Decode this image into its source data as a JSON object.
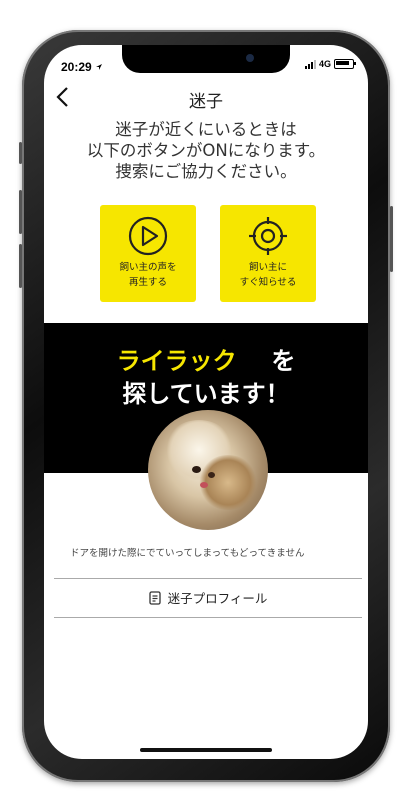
{
  "status_bar": {
    "time": "20:29",
    "network": "4G"
  },
  "nav": {
    "title": "迷子"
  },
  "intro": {
    "lines": [
      "迷子が近くにいるときは",
      "以下のボタンがONになります。",
      "捜索にご協力ください。"
    ]
  },
  "actions": {
    "play_voice": {
      "line1": "飼い主の声を",
      "line2": "再生する"
    },
    "notify_owner": {
      "line1": "飼い主に",
      "line2": "すぐ知らせる"
    }
  },
  "banner": {
    "pet_name": "ライラック",
    "particle": "を",
    "line2": "探しています！"
  },
  "description": "ドアを開けた際にでていってしまってもどってきません",
  "profile_link": {
    "label": "迷子プロフィール"
  },
  "colors": {
    "accent_yellow": "#f6e600",
    "banner_bg": "#000000"
  },
  "icons": {
    "back": "chevron-left-icon",
    "play": "play-circle-icon",
    "locate": "crosshair-icon",
    "profile": "document-icon"
  }
}
